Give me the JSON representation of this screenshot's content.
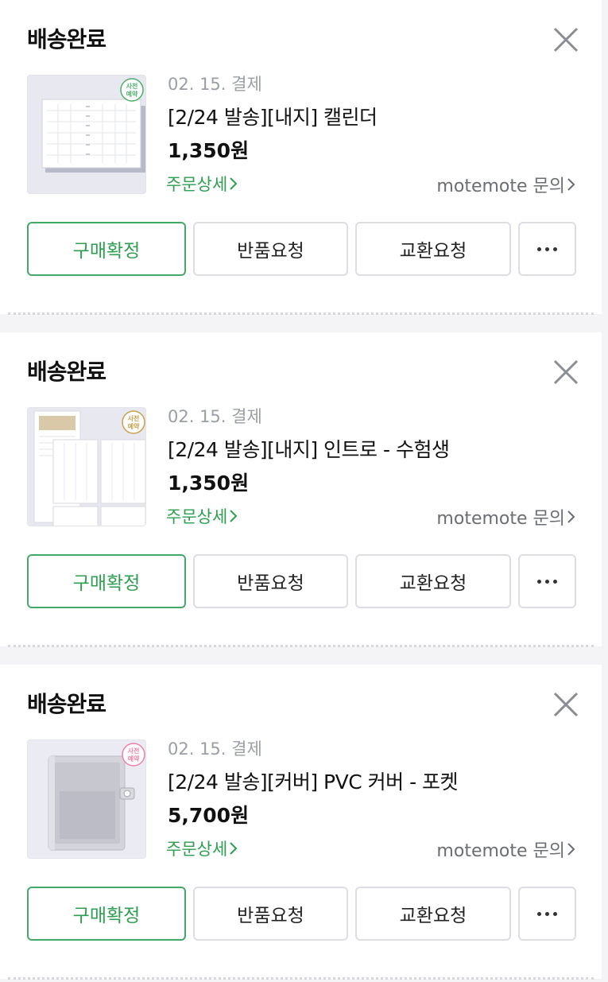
{
  "orders": [
    {
      "status": "배송완료",
      "pay_date": "02. 15. 결제",
      "product_name": "[2/24 발송][내지] 캘린더",
      "price": "1,350원",
      "detail_link": "주문상세",
      "inquiry_link": "motemote 문의",
      "badge_text": [
        "사전",
        "예약"
      ],
      "badge_color": "#4caf6b",
      "buttons": {
        "confirm": "구매확정",
        "return": "반품요청",
        "exchange": "교환요청"
      }
    },
    {
      "status": "배송완료",
      "pay_date": "02. 15. 결제",
      "product_name": "[2/24 발송][내지] 인트로 - 수험생",
      "price": "1,350원",
      "detail_link": "주문상세",
      "inquiry_link": "motemote 문의",
      "badge_text": [
        "사전",
        "예약"
      ],
      "badge_color": "#c9a04a",
      "buttons": {
        "confirm": "구매확정",
        "return": "반품요청",
        "exchange": "교환요청"
      }
    },
    {
      "status": "배송완료",
      "pay_date": "02. 15. 결제",
      "product_name": "[2/24 발송][커버] PVC 커버 - 포켓",
      "price": "5,700원",
      "detail_link": "주문상세",
      "inquiry_link": "motemote 문의",
      "badge_text": [
        "사전",
        "예약"
      ],
      "badge_color": "#ef7fa8",
      "buttons": {
        "confirm": "구매확정",
        "return": "반품요청",
        "exchange": "교환요청"
      }
    }
  ],
  "colors": {
    "accent": "#2e9e50",
    "muted": "#9a9ea6",
    "border": "#dcdee3"
  },
  "icons": {
    "close": "close-icon",
    "chevron": "chevron-right-icon",
    "more": "more-dots-icon"
  }
}
